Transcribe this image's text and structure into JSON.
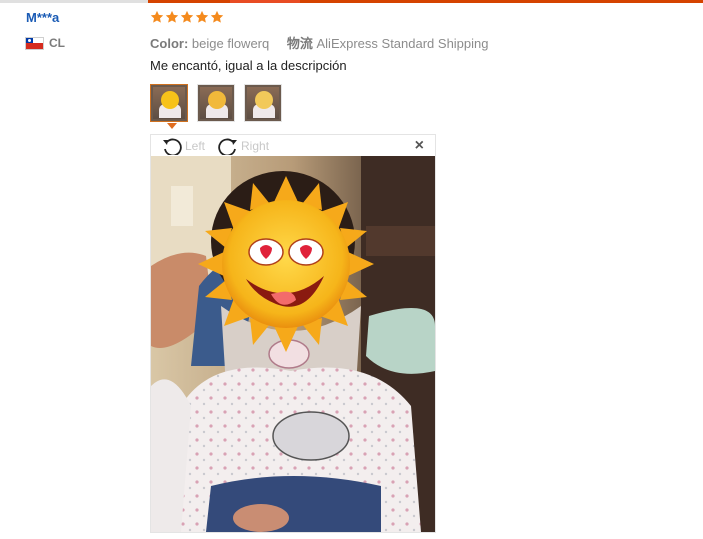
{
  "review": {
    "buyer_name": "M***a",
    "country_code": "CL",
    "rating": 5,
    "color_label": "Color:",
    "color_value": "beige flowerq",
    "shipping_label": "物流",
    "shipping_value": "AliExpress Standard Shipping",
    "text": "Me encantó, igual a la descripción",
    "photos_count": 3
  },
  "viewer": {
    "rotate_left_label": "Left",
    "rotate_right_label": "Right",
    "close_glyph": "×"
  },
  "colors": {
    "star": "#f48a1d",
    "name": "#1a5bb5",
    "accent_line": "#d54300"
  },
  "icons": {
    "rotate_left": "rotate-left-icon",
    "rotate_right": "rotate-right-icon",
    "close": "close-icon",
    "star": "star-icon",
    "flag": "flag-cl-icon"
  }
}
